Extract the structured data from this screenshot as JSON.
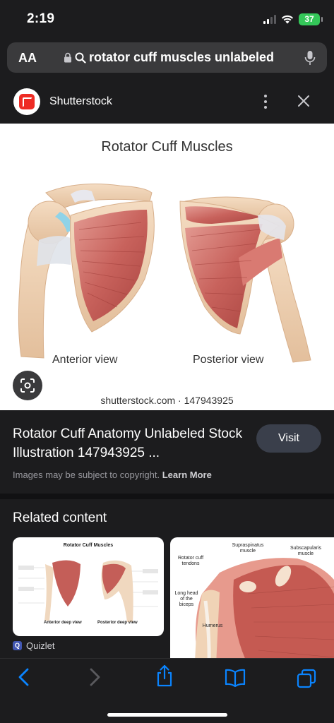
{
  "status_bar": {
    "time": "2:19",
    "battery": "37"
  },
  "browser": {
    "text_size_label": "AA",
    "url_text": "rotator cuff muscles unlabeled"
  },
  "source": {
    "name": "Shutterstock"
  },
  "image": {
    "title": "Rotator Cuff Muscles",
    "anterior_label": "Anterior view",
    "posterior_label": "Posterior view",
    "credit": "shutterstock.com · 147943925"
  },
  "details": {
    "title": "Rotator Cuff Anatomy Unlabeled Stock Illustration 147943925 ...",
    "visit_label": "Visit",
    "copyright_text": "Images may be subject to copyright.",
    "learn_more": "Learn More"
  },
  "related": {
    "heading": "Related content",
    "card1": {
      "title": "Rotator Cuff Muscles",
      "left_label": "Anterior deep view",
      "right_label": "Posterior deep view",
      "source": "Quizlet"
    },
    "card2": {
      "labels": {
        "supraspinatus": "Supraspinatus muscle",
        "subscapularis": "Subscapularis muscle",
        "rotator_tendons": "Rotator cuff tendons",
        "long_head": "Long head of the biceps",
        "humerus": "Humerus"
      }
    }
  },
  "colors": {
    "background": "#1c1c1e",
    "url_bar": "#3a3a3c",
    "accent_blue": "#0a84ff",
    "visit_button": "#3a3f4b",
    "battery_green": "#34c759",
    "shutterstock_red": "#ee2b24"
  },
  "icons": [
    "signal-icon",
    "wifi-icon",
    "battery-icon",
    "lock-icon",
    "search-icon",
    "microphone-icon",
    "more-vertical-icon",
    "close-icon",
    "lens-icon",
    "back-icon",
    "forward-icon",
    "share-icon",
    "bookmarks-icon",
    "tabs-icon"
  ]
}
